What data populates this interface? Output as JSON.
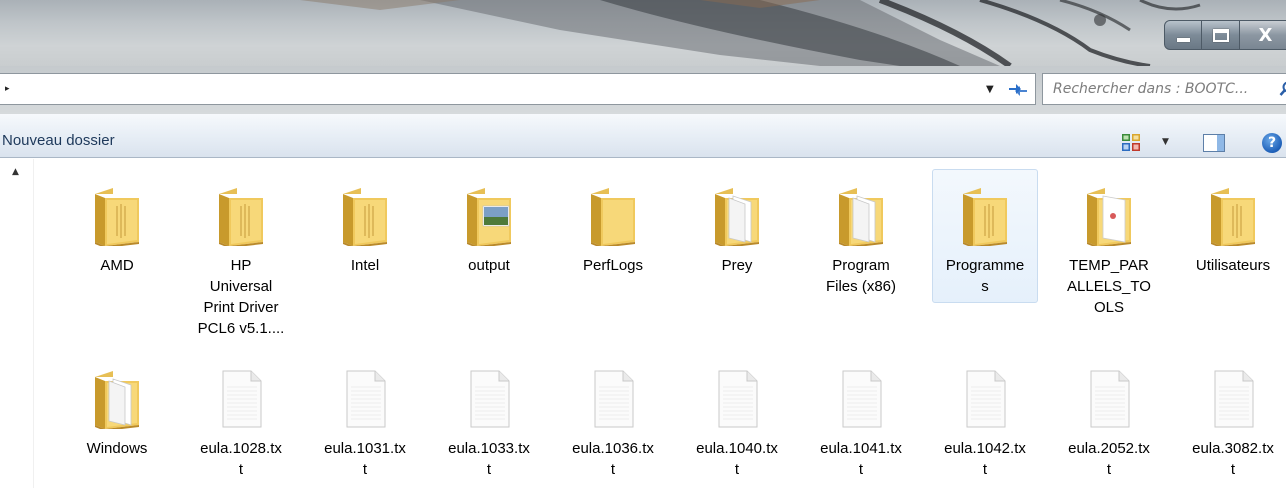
{
  "search": {
    "placeholder": "Rechercher dans : BOOTC..."
  },
  "toolbar": {
    "new_folder_label": "Nouveau dossier"
  },
  "window_controls": {
    "close_label": "X"
  },
  "help": {
    "label": "?"
  },
  "items": [
    {
      "name": "AMD",
      "type": "folder",
      "lines": [
        "AMD"
      ]
    },
    {
      "name": "HP Universal Print Driver PCL6 v5.1....",
      "type": "folder",
      "lines": [
        "HP",
        "Universal",
        "Print Driver",
        "PCL6 v5.1...."
      ]
    },
    {
      "name": "Intel",
      "type": "folder",
      "lines": [
        "Intel"
      ]
    },
    {
      "name": "output",
      "type": "folder-image",
      "lines": [
        "output"
      ]
    },
    {
      "name": "PerfLogs",
      "type": "folder-empty",
      "lines": [
        "PerfLogs"
      ]
    },
    {
      "name": "Prey",
      "type": "folder-docs",
      "lines": [
        "Prey"
      ]
    },
    {
      "name": "Program Files (x86)",
      "type": "folder-docs",
      "lines": [
        "Program",
        "Files (x86)"
      ]
    },
    {
      "name": "Programmes",
      "type": "folder",
      "lines": [
        "Programme",
        "s"
      ],
      "selected": true
    },
    {
      "name": "TEMP_PARALLELS_TOOLS",
      "type": "folder-file",
      "lines": [
        "TEMP_PAR",
        "ALLELS_TO",
        "OLS"
      ]
    },
    {
      "name": "Utilisateurs",
      "type": "folder",
      "lines": [
        "Utilisateurs"
      ]
    },
    {
      "name": "Windows",
      "type": "folder-docs",
      "lines": [
        "Windows"
      ]
    },
    {
      "name": "eula.1028.txt",
      "type": "txt",
      "lines": [
        "eula.1028.tx",
        "t"
      ]
    },
    {
      "name": "eula.1031.txt",
      "type": "txt",
      "lines": [
        "eula.1031.tx",
        "t"
      ]
    },
    {
      "name": "eula.1033.txt",
      "type": "txt",
      "lines": [
        "eula.1033.tx",
        "t"
      ]
    },
    {
      "name": "eula.1036.txt",
      "type": "txt",
      "lines": [
        "eula.1036.tx",
        "t"
      ]
    },
    {
      "name": "eula.1040.txt",
      "type": "txt",
      "lines": [
        "eula.1040.tx",
        "t"
      ]
    },
    {
      "name": "eula.1041.txt",
      "type": "txt",
      "lines": [
        "eula.1041.tx",
        "t"
      ]
    },
    {
      "name": "eula.1042.txt",
      "type": "txt",
      "lines": [
        "eula.1042.tx",
        "t"
      ]
    },
    {
      "name": "eula.2052.txt",
      "type": "txt",
      "lines": [
        "eula.2052.tx",
        "t"
      ]
    },
    {
      "name": "eula.3082.txt",
      "type": "txt",
      "lines": [
        "eula.3082.tx",
        "t"
      ]
    }
  ]
}
